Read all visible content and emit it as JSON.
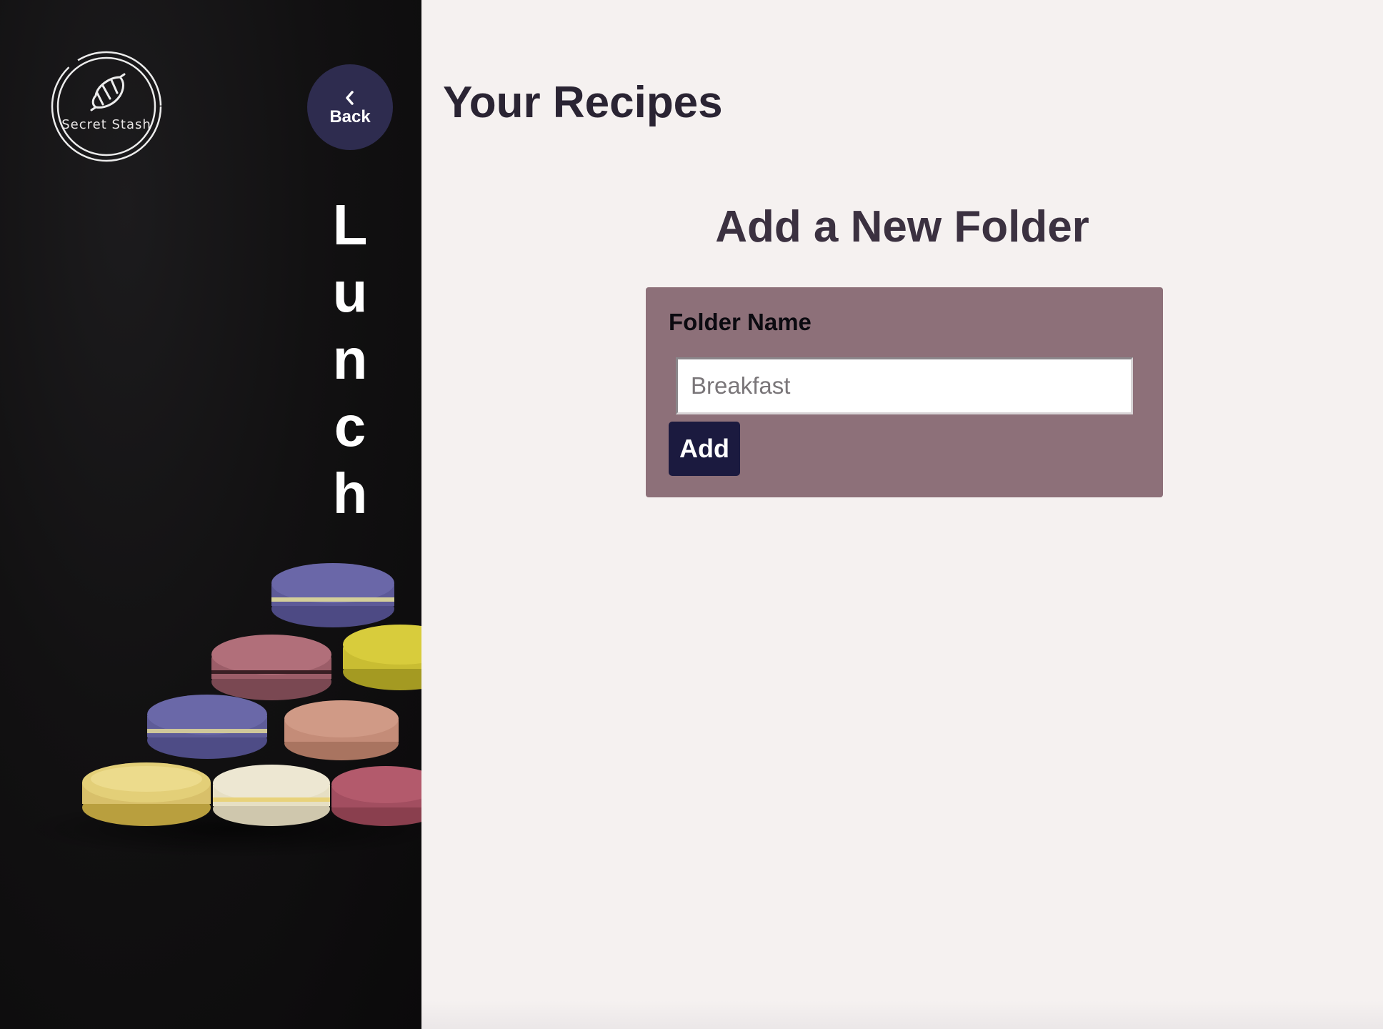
{
  "sidebar": {
    "logo": {
      "icon": "croissant-icon",
      "text": "Secret Stash"
    },
    "back_button": {
      "icon": "chevron-left-icon",
      "label": "Back"
    },
    "category_title": "Lunch",
    "image": "macarons-photo"
  },
  "main": {
    "page_title": "Your Recipes",
    "section_title": "Add a New Folder",
    "form": {
      "field_label": "Folder Name",
      "input_placeholder": "Breakfast",
      "input_value": "",
      "submit_label": "Add"
    }
  },
  "colors": {
    "page_background": "#f5f1f0",
    "sidebar_background": "#121112",
    "back_button": "#2e2c4f",
    "form_card": "#8d7079",
    "add_button": "#1b1a3f",
    "heading_text": "#2a2433"
  }
}
